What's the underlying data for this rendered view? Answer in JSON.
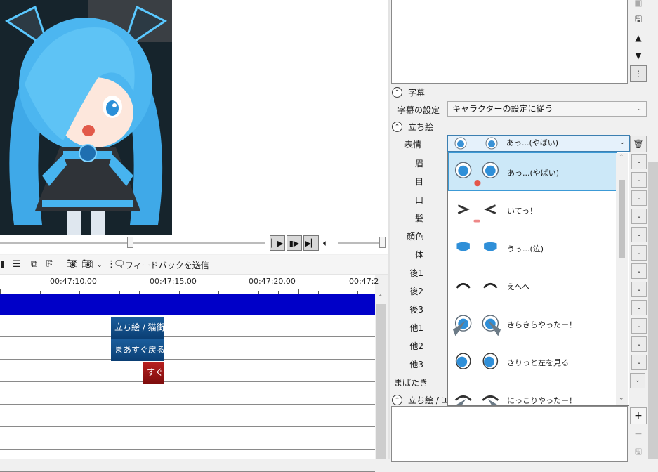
{
  "timeline": {
    "ruler_labels": [
      "00:47:10.00",
      "00:47:15.00",
      "00:47:20.00",
      "00:47:2"
    ],
    "clips": [
      {
        "text": "立ち絵 / 猫街"
      },
      {
        "text": "まあすぐ戻る/"
      },
      {
        "text": "すぐ"
      }
    ],
    "colors": {
      "master_bar": "#0000c8",
      "clip_blue": "#0f4c87",
      "clip_red": "#9b1414"
    }
  },
  "toolbar": {
    "feedback_label": "フィードバックを送信"
  },
  "panel": {
    "subtitle_section": "字幕",
    "subtitle_setting_label": "字幕の設定",
    "subtitle_setting_value": "キャラクターの設定に従う",
    "tachie_section": "立ち絵",
    "expression_label": "表情",
    "expression_value": "あっ...(やばい)",
    "part_labels": [
      "眉",
      "目",
      "口",
      "髪",
      "顔色",
      "体",
      "後1",
      "後2",
      "後3",
      "他1",
      "他2",
      "他3",
      "まばたき"
    ],
    "effect_section": "立ち絵 / エ"
  },
  "dropdown": {
    "options": [
      {
        "label": "あっ...(やばい)",
        "selected": true
      },
      {
        "label": "いてっ！",
        "selected": false
      },
      {
        "label": "うぅ...(泣)",
        "selected": false
      },
      {
        "label": "えへへ",
        "selected": false
      },
      {
        "label": "きらきらやったー！",
        "selected": false
      },
      {
        "label": "きりっと左を見る",
        "selected": false
      },
      {
        "label": "にっこりやったー！",
        "selected": false
      }
    ],
    "selected_bg": "#cce8f8"
  },
  "icons": [
    "play-icon",
    "step-icon",
    "next-icon",
    "volume-icon",
    "camera-icon",
    "feedback-icon",
    "up-arrow-icon",
    "down-arrow-icon",
    "more-icon",
    "trash-icon",
    "plus-icon",
    "minus-icon",
    "save-icon"
  ]
}
